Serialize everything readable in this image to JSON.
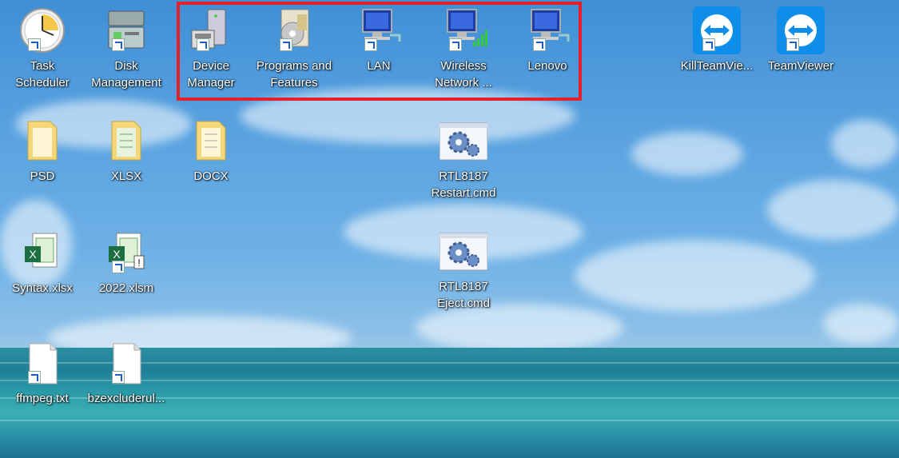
{
  "highlight_color": "#e5202a",
  "icons": {
    "task_scheduler": {
      "line1": "Task",
      "line2": "Scheduler",
      "icon": "clock-icon"
    },
    "disk_management": {
      "line1": "Disk",
      "line2": "Management",
      "icon": "disk-management-icon"
    },
    "device_manager": {
      "line1": "Device",
      "line2": "Manager",
      "icon": "device-manager-icon"
    },
    "programs_features": {
      "line1": "Programs and",
      "line2": "Features",
      "icon": "programs-features-icon"
    },
    "lan": {
      "line1": "LAN",
      "icon": "network-icon"
    },
    "wireless": {
      "line1": "Wireless",
      "line2": "Network ...",
      "icon": "wireless-network-icon"
    },
    "lenovo": {
      "line1": "Lenovo",
      "icon": "network-icon"
    },
    "kill_teamviewer": {
      "line1": "KillTeamVie...",
      "icon": "teamviewer-icon"
    },
    "teamviewer": {
      "line1": "TeamViewer",
      "icon": "teamviewer-icon"
    },
    "psd": {
      "line1": "PSD",
      "icon": "folder-icon"
    },
    "xlsx": {
      "line1": "XLSX",
      "icon": "folder-icon"
    },
    "docx": {
      "line1": "DOCX",
      "icon": "folder-icon"
    },
    "rtl_restart": {
      "line1": "RTL8187",
      "line2": "Restart.cmd",
      "icon": "cmd-gear-icon"
    },
    "syntax_xlsx": {
      "line1": "Syntax.xlsx",
      "icon": "excel-icon"
    },
    "xlsm_2022": {
      "line1": "2022.xlsm",
      "icon": "excel-macro-icon"
    },
    "rtl_eject": {
      "line1": "RTL8187",
      "line2": "Eject.cmd",
      "icon": "cmd-gear-icon"
    },
    "ffmpeg": {
      "line1": "ffmpeg.txt",
      "icon": "text-file-icon"
    },
    "bzexclude": {
      "line1": "bzexcluderul...",
      "icon": "text-file-icon"
    }
  }
}
